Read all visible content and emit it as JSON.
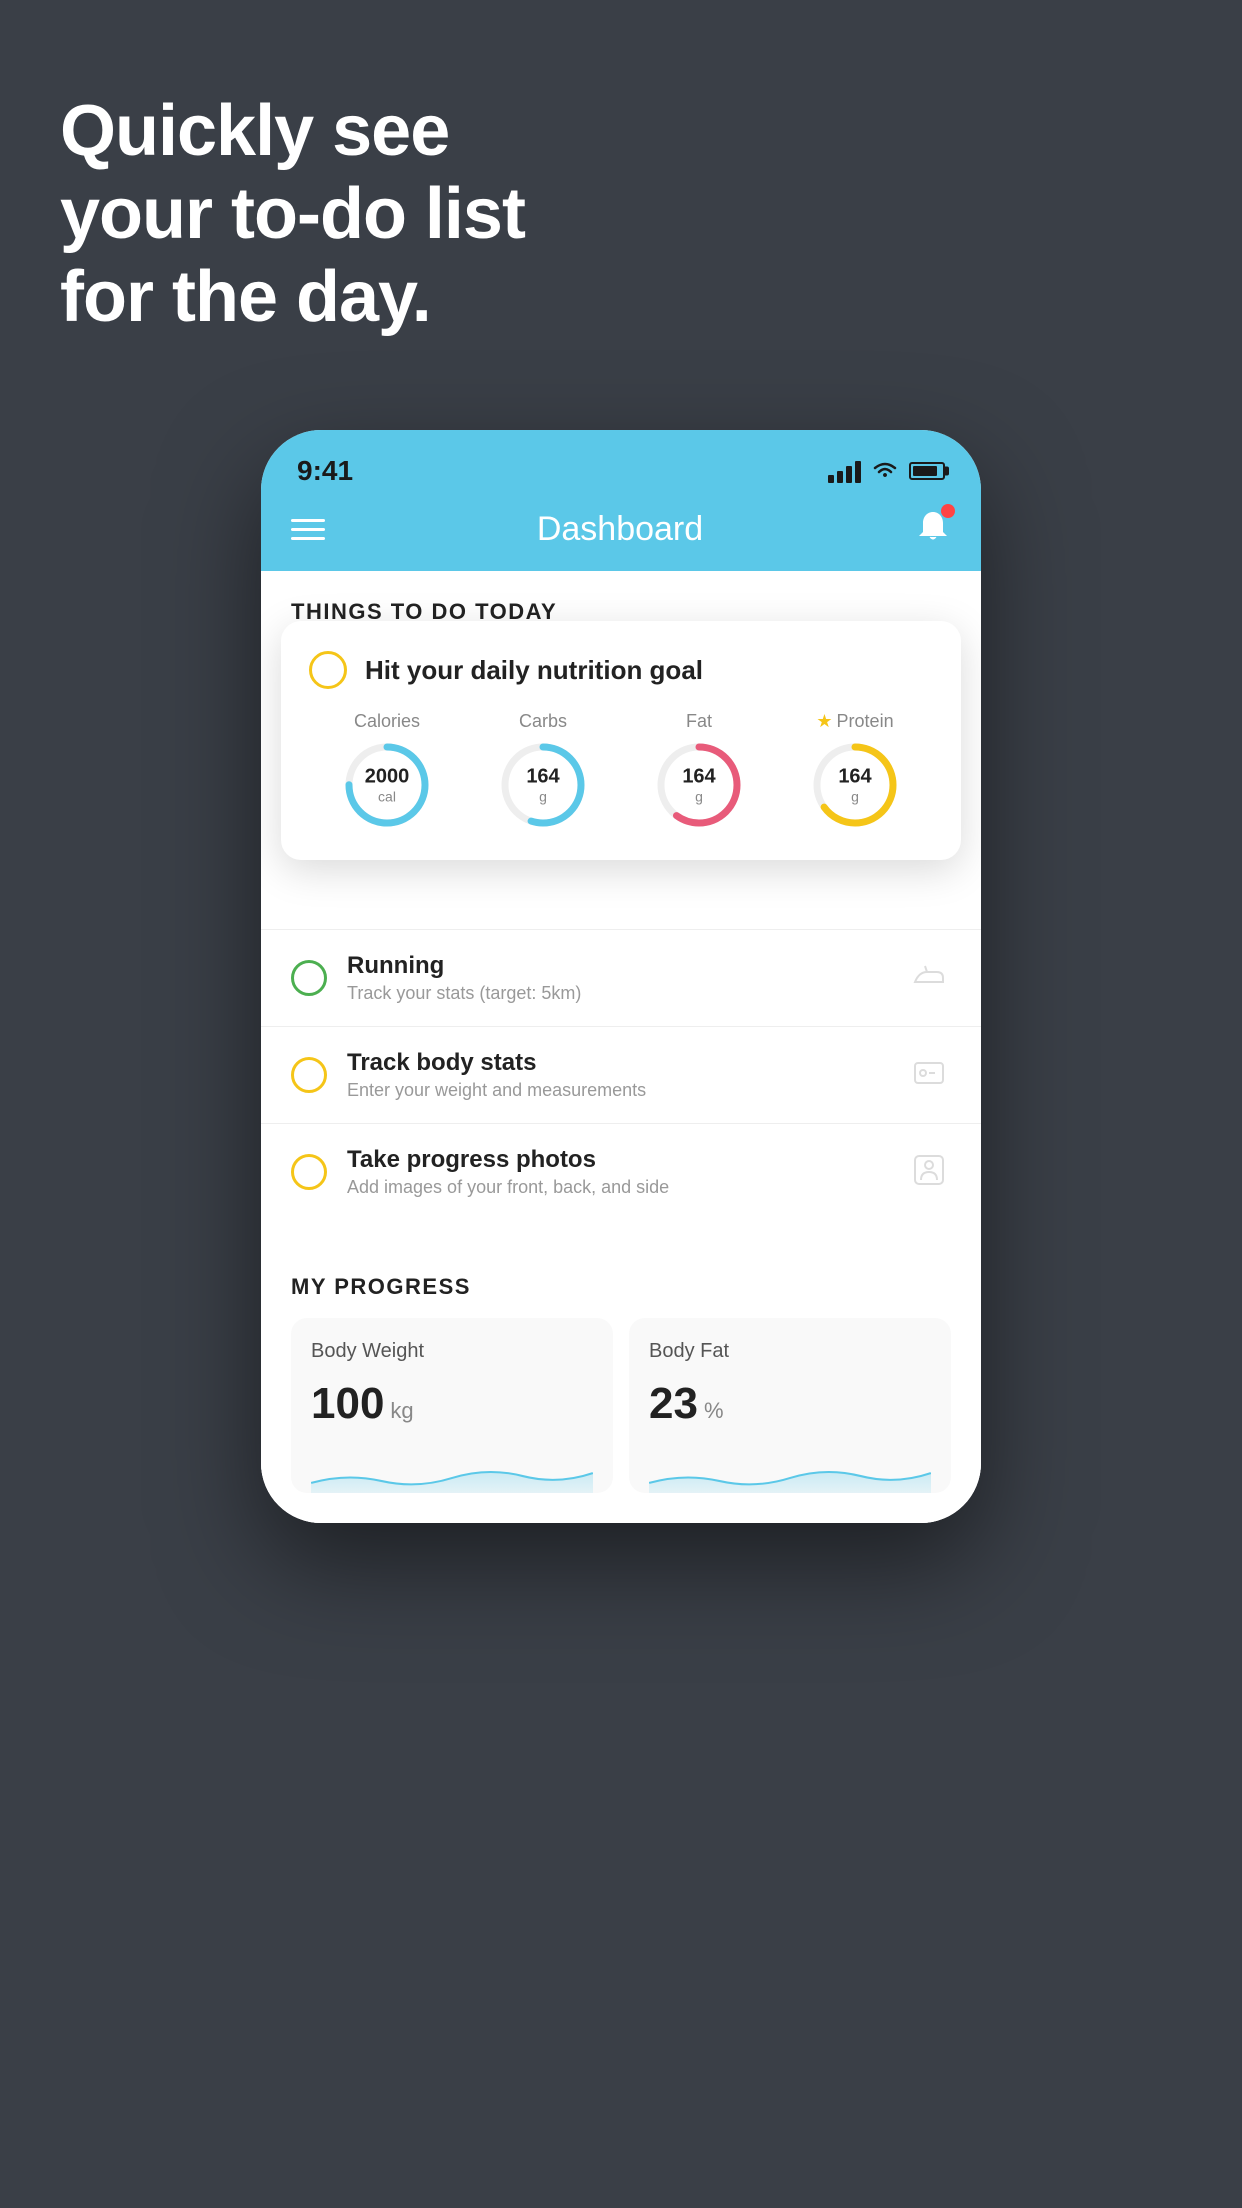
{
  "background_color": "#3a3f47",
  "hero": {
    "line1": "Quickly see",
    "line2": "your to-do list",
    "line3": "for the day."
  },
  "phone": {
    "status_bar": {
      "time": "9:41"
    },
    "nav": {
      "title": "Dashboard"
    },
    "things_section": {
      "heading": "THINGS TO DO TODAY"
    },
    "floating_card": {
      "title": "Hit your daily nutrition goal",
      "nutrition": [
        {
          "label": "Calories",
          "value": "2000",
          "unit": "cal",
          "color": "#5bc8e8",
          "track_pct": 75,
          "starred": false
        },
        {
          "label": "Carbs",
          "value": "164",
          "unit": "g",
          "color": "#5bc8e8",
          "track_pct": 55,
          "starred": false
        },
        {
          "label": "Fat",
          "value": "164",
          "unit": "g",
          "color": "#e85b7a",
          "track_pct": 60,
          "starred": false
        },
        {
          "label": "Protein",
          "value": "164",
          "unit": "g",
          "color": "#f5c518",
          "track_pct": 65,
          "starred": true
        }
      ]
    },
    "todo_items": [
      {
        "id": 1,
        "circle_color": "green",
        "title": "Running",
        "subtitle": "Track your stats (target: 5km)",
        "icon": "shoe"
      },
      {
        "id": 2,
        "circle_color": "yellow",
        "title": "Track body stats",
        "subtitle": "Enter your weight and measurements",
        "icon": "scale"
      },
      {
        "id": 3,
        "circle_color": "yellow2",
        "title": "Take progress photos",
        "subtitle": "Add images of your front, back, and side",
        "icon": "person"
      }
    ],
    "progress_section": {
      "heading": "MY PROGRESS",
      "cards": [
        {
          "title": "Body Weight",
          "value": "100",
          "unit": "kg"
        },
        {
          "title": "Body Fat",
          "value": "23",
          "unit": "%"
        }
      ]
    }
  }
}
